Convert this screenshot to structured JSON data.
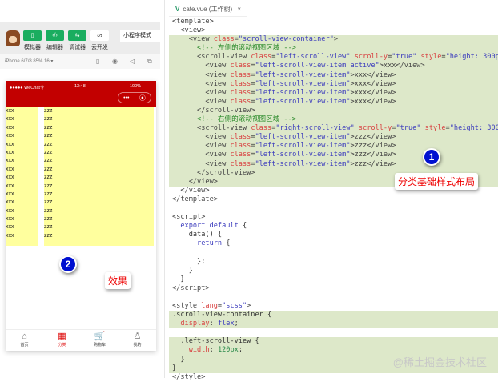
{
  "toolbar": {
    "buttons": [
      {
        "label": "模拟器",
        "icon": "phone-icon",
        "glyph": "▯"
      },
      {
        "label": "编辑器",
        "icon": "code-icon",
        "glyph": "‹/›"
      },
      {
        "label": "调试器",
        "icon": "debug-icon",
        "glyph": "⇆"
      },
      {
        "label": "云开发",
        "icon": "cloud-icon",
        "glyph": "ᔕ"
      }
    ],
    "mode": "小程序模式"
  },
  "device": {
    "label": "iPhone 6/7/8 85% 16 ▾"
  },
  "phone": {
    "carrier": "●●●●● WeChat令",
    "time": "13:48",
    "battery": "100%",
    "capsule_more": "•••",
    "capsule_close": "⦿",
    "left_items": [
      "xxx",
      "xxx",
      "xxx",
      "xxx",
      "xxx",
      "xxx",
      "xxx",
      "xxx",
      "xxx",
      "xxx",
      "xxx",
      "xxx",
      "xxx",
      "xxx",
      "xxx",
      "xxx"
    ],
    "right_items": [
      "zzz",
      "zzz",
      "zzz",
      "zzz",
      "zzz",
      "zzz",
      "zzz",
      "zzz",
      "zzz",
      "zzz",
      "zzz",
      "zzz",
      "zzz",
      "zzz",
      "zzz",
      "zzz"
    ],
    "tabs": [
      {
        "label": "首页",
        "glyph": "⌂",
        "active": false
      },
      {
        "label": "分类",
        "glyph": "▦",
        "active": true
      },
      {
        "label": "购物车",
        "glyph": "🛒",
        "active": false
      },
      {
        "label": "我的",
        "glyph": "♙",
        "active": false
      }
    ]
  },
  "annotations": {
    "badge1": "1",
    "note1": "分类基础样式布局",
    "badge2": "2",
    "note2": "效果"
  },
  "editor": {
    "tab_label": "cate.vue (工作树)",
    "tab_close": "×",
    "lines": [
      {
        "hl": false,
        "t": [
          [
            "<template>",
            "tag"
          ]
        ]
      },
      {
        "hl": false,
        "t": [
          [
            "  <view>",
            "tag"
          ]
        ]
      },
      {
        "hl": true,
        "t": [
          [
            "    <view ",
            "tag"
          ],
          [
            "class",
            "attr"
          ],
          [
            "=",
            "txt"
          ],
          [
            "\"scroll-view-container\"",
            "str"
          ],
          [
            ">",
            "tag"
          ]
        ]
      },
      {
        "hl": true,
        "t": [
          [
            "      <!-- 左侧的滚动视图区域 -->",
            "cmt"
          ]
        ]
      },
      {
        "hl": true,
        "t": [
          [
            "      <scroll-view ",
            "tag"
          ],
          [
            "class",
            "attr"
          ],
          [
            "=",
            "txt"
          ],
          [
            "\"left-scroll-view\" ",
            "str"
          ],
          [
            "scroll-y",
            "attr"
          ],
          [
            "=",
            "txt"
          ],
          [
            "\"true\" ",
            "str"
          ],
          [
            "style",
            "attr"
          ],
          [
            "=",
            "txt"
          ],
          [
            "\"height: 300px\"",
            "str"
          ],
          [
            ">",
            "tag"
          ]
        ]
      },
      {
        "hl": true,
        "t": [
          [
            "        <view ",
            "tag"
          ],
          [
            "class",
            "attr"
          ],
          [
            "=",
            "txt"
          ],
          [
            "\"left-scroll-view-item active\"",
            "str"
          ],
          [
            ">xxx</view>",
            "tag"
          ]
        ]
      },
      {
        "hl": true,
        "t": [
          [
            "        <view ",
            "tag"
          ],
          [
            "class",
            "attr"
          ],
          [
            "=",
            "txt"
          ],
          [
            "\"left-scroll-view-item\"",
            "str"
          ],
          [
            ">xxx</view>",
            "tag"
          ]
        ]
      },
      {
        "hl": true,
        "t": [
          [
            "        <view ",
            "tag"
          ],
          [
            "class",
            "attr"
          ],
          [
            "=",
            "txt"
          ],
          [
            "\"left-scroll-view-item\"",
            "str"
          ],
          [
            ">xxx</view>",
            "tag"
          ]
        ]
      },
      {
        "hl": true,
        "t": [
          [
            "        <view ",
            "tag"
          ],
          [
            "class",
            "attr"
          ],
          [
            "=",
            "txt"
          ],
          [
            "\"left-scroll-view-item\"",
            "str"
          ],
          [
            ">xxx</view>",
            "tag"
          ]
        ]
      },
      {
        "hl": true,
        "t": [
          [
            "        <view ",
            "tag"
          ],
          [
            "class",
            "attr"
          ],
          [
            "=",
            "txt"
          ],
          [
            "\"left-scroll-view-item\"",
            "str"
          ],
          [
            ">xxx</view>",
            "tag"
          ]
        ]
      },
      {
        "hl": true,
        "t": [
          [
            "      </scroll-view>",
            "tag"
          ]
        ]
      },
      {
        "hl": true,
        "t": [
          [
            "      <!-- 右侧的滚动视图区域 -->",
            "cmt"
          ]
        ]
      },
      {
        "hl": true,
        "t": [
          [
            "      <scroll-view ",
            "tag"
          ],
          [
            "class",
            "attr"
          ],
          [
            "=",
            "txt"
          ],
          [
            "\"right-scroll-view\" ",
            "str"
          ],
          [
            "scroll-y",
            "attr"
          ],
          [
            "=",
            "txt"
          ],
          [
            "\"true\" ",
            "str"
          ],
          [
            "style",
            "attr"
          ],
          [
            "=",
            "txt"
          ],
          [
            "\"height: 300px\"",
            "str"
          ],
          [
            ">",
            "tag"
          ]
        ]
      },
      {
        "hl": true,
        "t": [
          [
            "        <view ",
            "tag"
          ],
          [
            "class",
            "attr"
          ],
          [
            "=",
            "txt"
          ],
          [
            "\"left-scroll-view-item\"",
            "str"
          ],
          [
            ">zzz</view>",
            "tag"
          ]
        ]
      },
      {
        "hl": true,
        "t": [
          [
            "        <view ",
            "tag"
          ],
          [
            "class",
            "attr"
          ],
          [
            "=",
            "txt"
          ],
          [
            "\"left-scroll-view-item\"",
            "str"
          ],
          [
            ">zzz</view>",
            "tag"
          ]
        ]
      },
      {
        "hl": true,
        "t": [
          [
            "        <view ",
            "tag"
          ],
          [
            "class",
            "attr"
          ],
          [
            "=",
            "txt"
          ],
          [
            "\"left-scroll-view-item\"",
            "str"
          ],
          [
            ">zzz</view>",
            "tag"
          ]
        ]
      },
      {
        "hl": true,
        "t": [
          [
            "        <view ",
            "tag"
          ],
          [
            "class",
            "attr"
          ],
          [
            "=",
            "txt"
          ],
          [
            "\"left-scroll-view-item\"",
            "str"
          ],
          [
            ">zzz</view>",
            "tag"
          ]
        ]
      },
      {
        "hl": true,
        "t": [
          [
            "      </scroll-view>",
            "tag"
          ]
        ]
      },
      {
        "hl": true,
        "t": [
          [
            "    </view>",
            "tag"
          ]
        ]
      },
      {
        "hl": false,
        "t": [
          [
            "  </view>",
            "tag"
          ]
        ]
      },
      {
        "hl": false,
        "t": [
          [
            "</template>",
            "tag"
          ]
        ]
      },
      {
        "hl": false,
        "t": [
          [
            "",
            "txt"
          ]
        ]
      },
      {
        "hl": false,
        "t": [
          [
            "<script>",
            "tag"
          ]
        ]
      },
      {
        "hl": false,
        "t": [
          [
            "  export default ",
            "kw"
          ],
          [
            "{",
            "txt"
          ]
        ]
      },
      {
        "hl": false,
        "t": [
          [
            "    data() {",
            "txt"
          ]
        ]
      },
      {
        "hl": false,
        "t": [
          [
            "      return ",
            "kw"
          ],
          [
            "{",
            "txt"
          ]
        ]
      },
      {
        "hl": false,
        "t": [
          [
            "",
            "txt"
          ]
        ]
      },
      {
        "hl": false,
        "t": [
          [
            "      };",
            "txt"
          ]
        ]
      },
      {
        "hl": false,
        "t": [
          [
            "    }",
            "txt"
          ]
        ]
      },
      {
        "hl": false,
        "t": [
          [
            "  }",
            "txt"
          ]
        ]
      },
      {
        "hl": false,
        "t": [
          [
            "</script>",
            "tag"
          ]
        ]
      },
      {
        "hl": false,
        "t": [
          [
            "",
            "txt"
          ]
        ]
      },
      {
        "hl": false,
        "t": [
          [
            "<style ",
            "tag"
          ],
          [
            "lang",
            "attr"
          ],
          [
            "=",
            "txt"
          ],
          [
            "\"scss\"",
            "str"
          ],
          [
            ">",
            "tag"
          ]
        ]
      },
      {
        "hl": true,
        "t": [
          [
            ".scroll-view-container {",
            "txt"
          ]
        ]
      },
      {
        "hl": true,
        "t": [
          [
            "  display",
            "attr"
          ],
          [
            ": ",
            "txt"
          ],
          [
            "flex",
            "str"
          ],
          [
            ";",
            "txt"
          ]
        ]
      },
      {
        "hl": false,
        "t": [
          [
            "",
            "txt"
          ]
        ]
      },
      {
        "hl": true,
        "t": [
          [
            "  .left-scroll-view {",
            "txt"
          ]
        ]
      },
      {
        "hl": true,
        "t": [
          [
            "    width",
            "attr"
          ],
          [
            ": ",
            "txt"
          ],
          [
            "120px",
            "num"
          ],
          [
            ";",
            "txt"
          ]
        ]
      },
      {
        "hl": true,
        "t": [
          [
            "  }",
            "txt"
          ]
        ]
      },
      {
        "hl": true,
        "t": [
          [
            "}",
            "txt"
          ]
        ]
      },
      {
        "hl": false,
        "t": [
          [
            "</style>",
            "tag"
          ]
        ]
      }
    ]
  },
  "watermark": "@稀土掘金技术社区"
}
